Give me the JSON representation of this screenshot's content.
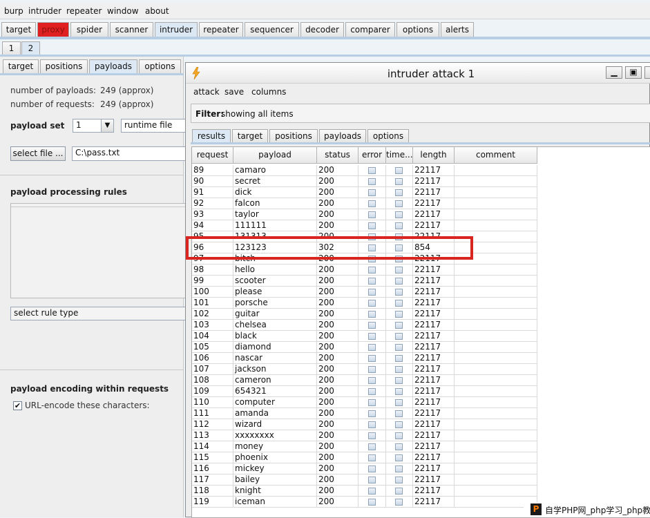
{
  "menu": [
    "burp",
    "intruder",
    "repeater",
    "window",
    "about"
  ],
  "main_tabs": [
    "target",
    "proxy",
    "spider",
    "scanner",
    "intruder",
    "repeater",
    "sequencer",
    "decoder",
    "comparer",
    "options",
    "alerts"
  ],
  "sub_tabs": [
    "1",
    "2"
  ],
  "left": {
    "tabs": [
      "target",
      "positions",
      "payloads",
      "options"
    ],
    "num_payloads_label": "number of payloads:",
    "num_payloads_value": "249 (approx)",
    "num_requests_label": "number of requests:",
    "num_requests_value": "249 (approx)",
    "payload_set_label": "payload set",
    "payload_set_value": "1",
    "payload_type_value": "runtime file",
    "select_file_label": "select file ...",
    "file_path": "C:\\pass.txt",
    "processing_rules_heading": "payload processing rules",
    "select_rule_type": "select rule type",
    "encoding_heading": "payload encoding within requests",
    "url_encode_label": "URL-encode these characters:"
  },
  "attack": {
    "title": "intruder attack 1",
    "menu": [
      "attack",
      "save",
      "columns"
    ],
    "filter_label": "Filter:",
    "filter_value": "showing all items",
    "tabs": [
      "results",
      "target",
      "positions",
      "payloads",
      "options"
    ],
    "columns": [
      "request",
      "payload",
      "status",
      "error",
      "time...",
      "length",
      "comment"
    ],
    "rows": [
      {
        "request": "89",
        "payload": "camaro",
        "status": "200",
        "length": "22117"
      },
      {
        "request": "90",
        "payload": "secret",
        "status": "200",
        "length": "22117"
      },
      {
        "request": "91",
        "payload": "dick",
        "status": "200",
        "length": "22117"
      },
      {
        "request": "92",
        "payload": "falcon",
        "status": "200",
        "length": "22117"
      },
      {
        "request": "93",
        "payload": "taylor",
        "status": "200",
        "length": "22117"
      },
      {
        "request": "94",
        "payload": "111111",
        "status": "200",
        "length": "22117"
      },
      {
        "request": "95",
        "payload": "131313",
        "status": "200",
        "length": "22117"
      },
      {
        "request": "96",
        "payload": "123123",
        "status": "302",
        "length": "854"
      },
      {
        "request": "97",
        "payload": "bitch",
        "status": "200",
        "length": "22117"
      },
      {
        "request": "98",
        "payload": "hello",
        "status": "200",
        "length": "22117"
      },
      {
        "request": "99",
        "payload": "scooter",
        "status": "200",
        "length": "22117"
      },
      {
        "request": "100",
        "payload": "please",
        "status": "200",
        "length": "22117"
      },
      {
        "request": "101",
        "payload": "porsche",
        "status": "200",
        "length": "22117"
      },
      {
        "request": "102",
        "payload": "guitar",
        "status": "200",
        "length": "22117"
      },
      {
        "request": "103",
        "payload": "chelsea",
        "status": "200",
        "length": "22117"
      },
      {
        "request": "104",
        "payload": "black",
        "status": "200",
        "length": "22117"
      },
      {
        "request": "105",
        "payload": "diamond",
        "status": "200",
        "length": "22117"
      },
      {
        "request": "106",
        "payload": "nascar",
        "status": "200",
        "length": "22117"
      },
      {
        "request": "107",
        "payload": "jackson",
        "status": "200",
        "length": "22117"
      },
      {
        "request": "108",
        "payload": "cameron",
        "status": "200",
        "length": "22117"
      },
      {
        "request": "109",
        "payload": "654321",
        "status": "200",
        "length": "22117"
      },
      {
        "request": "110",
        "payload": "computer",
        "status": "200",
        "length": "22117"
      },
      {
        "request": "111",
        "payload": "amanda",
        "status": "200",
        "length": "22117"
      },
      {
        "request": "112",
        "payload": "wizard",
        "status": "200",
        "length": "22117"
      },
      {
        "request": "113",
        "payload": "xxxxxxxx",
        "status": "200",
        "length": "22117"
      },
      {
        "request": "114",
        "payload": "money",
        "status": "200",
        "length": "22117"
      },
      {
        "request": "115",
        "payload": "phoenix",
        "status": "200",
        "length": "22117"
      },
      {
        "request": "116",
        "payload": "mickey",
        "status": "200",
        "length": "22117"
      },
      {
        "request": "117",
        "payload": "bailey",
        "status": "200",
        "length": "22117"
      },
      {
        "request": "118",
        "payload": "knight",
        "status": "200",
        "length": "22117"
      },
      {
        "request": "119",
        "payload": "iceman",
        "status": "200",
        "length": "22117"
      }
    ]
  },
  "watermark": {
    "logo": "P",
    "text": "自学PHP网_php学习_php教"
  },
  "colors": {
    "accent_red": "#d9251f",
    "tab_active": "#dce9f5",
    "proxy_tab": "#e02020"
  }
}
